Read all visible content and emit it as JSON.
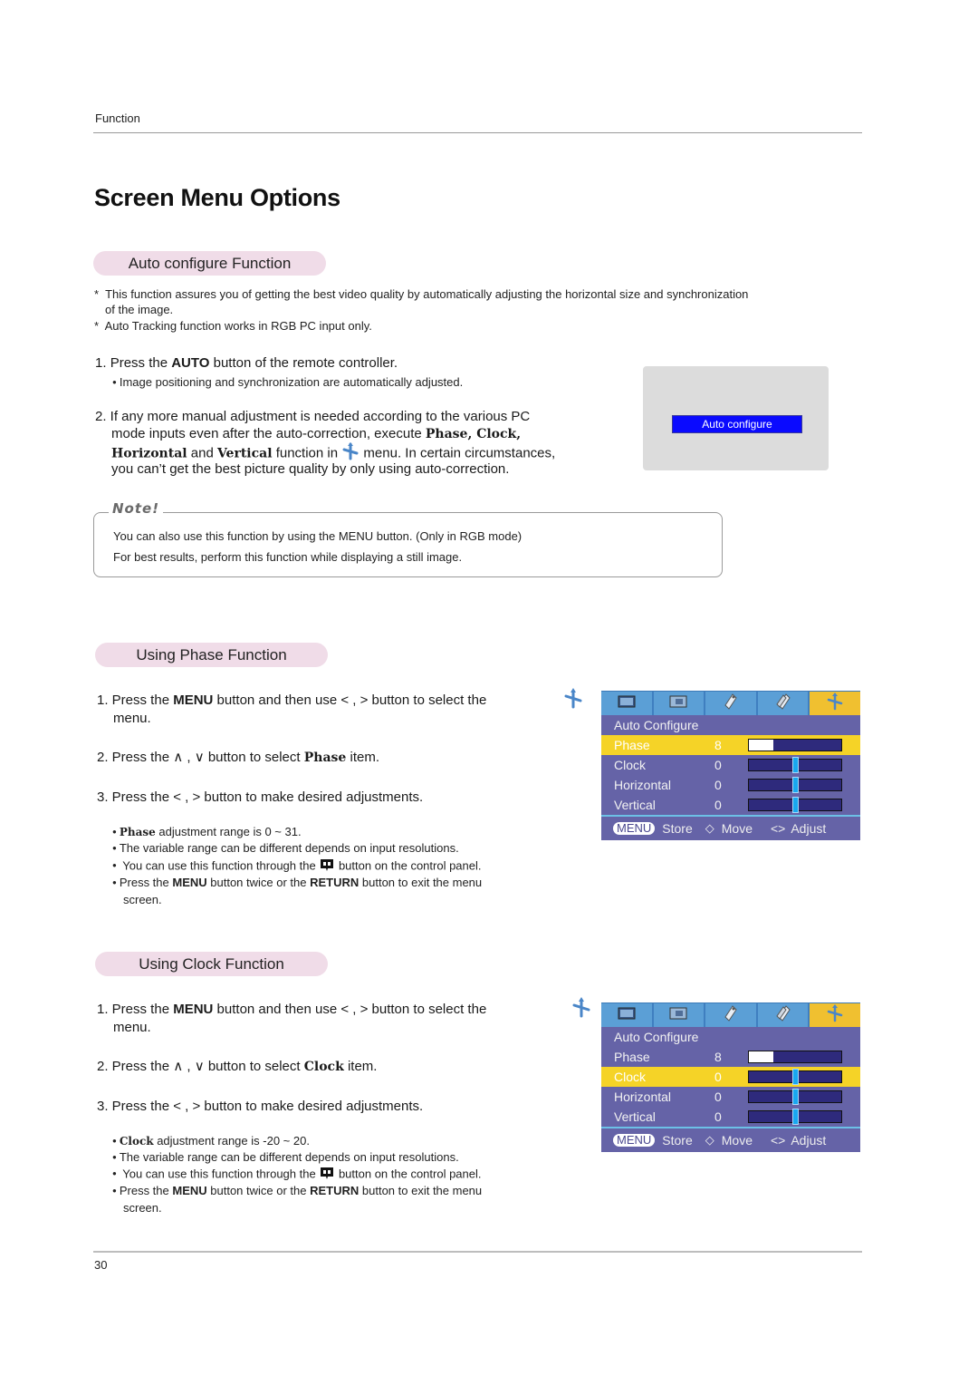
{
  "header": {
    "section_label": "Function"
  },
  "page_title": "Screen Menu Options",
  "auto_configure": {
    "heading": "Auto configure Function",
    "notes": [
      "This function assures you of getting the best video quality by automatically adjusting the horizontal size and synchronization",
      "of the image.",
      "Auto Tracking function works in RGB PC input only."
    ],
    "step1": {
      "num": "1.",
      "pre": "Press the ",
      "bold": "AUTO",
      "post": " button of the remote controller."
    },
    "step1_bullet": "Image positioning and synchronization are automatically adjusted.",
    "step2": {
      "line1": "2. If any more manual adjustment is needed according to the various PC",
      "line2_pre": "mode inputs even after the auto-correction, execute ",
      "line2_bold": "Phase, Clock,",
      "line3_bold1": "Horizontal",
      "line3_mid": " and ",
      "line3_bold2": "Vertical",
      "line3_post": " function in ",
      "line3_end": " menu. In certain circumstances,",
      "line4": "you can’t get the best picture quality by only using auto-correction."
    },
    "screen_button": "Auto configure",
    "note_title": "Note!",
    "note_lines": [
      "You can also use this function by using the MENU button. (Only in RGB mode)",
      "For best results, perform this function while displaying a still image."
    ]
  },
  "phase": {
    "heading": "Using Phase Function",
    "step1_a": "1. Press the ",
    "step1_bold": "MENU",
    "step1_b": " button and then use < , > button to select the",
    "step1_c": "menu.",
    "step2_a": "2. Press the ∧ , ∨ button to select ",
    "step2_bold": "Phase",
    "step2_b": " item.",
    "step3": "3. Press the < , > button to make desired adjustments.",
    "bullet1_bold": "Phase",
    "bullet1": " adjustment range is 0 ~ 31.",
    "bullet2": "The variable range can be different depends on input resolutions.",
    "bullet3_a": "You can use this function through the",
    "bullet3_b": "button on the control panel.",
    "bullet4_a": "Press the ",
    "bullet4_bold1": "MENU",
    "bullet4_b": " button twice or the ",
    "bullet4_bold2": "RETURN",
    "bullet4_c": " button to exit the menu",
    "bullet4_d": "screen."
  },
  "clock": {
    "heading": "Using Clock Function",
    "step1_a": "1. Press the ",
    "step1_bold": "MENU",
    "step1_b": " button and then use < , > button to select the",
    "step1_c": "menu.",
    "step2_a": "2. Press the ∧ , ∨ button to select ",
    "step2_bold": "Clock",
    "step2_b": " item.",
    "step3": "3. Press the < , > button to make desired adjustments.",
    "bullet1_bold": "Clock",
    "bullet1": " adjustment range is -20 ~ 20.",
    "bullet2": "The variable range can be different depends on input resolutions.",
    "bullet3_a": "You can use this function through the",
    "bullet3_b": "button on the control panel.",
    "bullet4_a": "Press the ",
    "bullet4_bold1": "MENU",
    "bullet4_b": " button twice or the ",
    "bullet4_bold2": "RETURN",
    "bullet4_c": " button to exit the menu",
    "bullet4_d": "screen."
  },
  "osd_phase": {
    "tabs": [
      "picture-icon",
      "screen-icon",
      "tag-icon",
      "tags-icon",
      "move-cross-icon"
    ],
    "title_row": "Auto Configure",
    "rows": [
      {
        "label": "Phase",
        "value": "8",
        "kind": "fill",
        "fraction": 0.26,
        "selected": true
      },
      {
        "label": "Clock",
        "value": "0",
        "kind": "knob",
        "fraction": 0.5,
        "selected": false
      },
      {
        "label": "Horizontal",
        "value": "0",
        "kind": "knob",
        "fraction": 0.5,
        "selected": false
      },
      {
        "label": "Vertical",
        "value": "0",
        "kind": "knob",
        "fraction": 0.5,
        "selected": false
      }
    ],
    "footer": {
      "menu": "MENU",
      "store": "Store",
      "move_icon": "◇",
      "move": "Move",
      "adjust_icon": "<>",
      "adjust": "Adjust"
    }
  },
  "osd_clock": {
    "tabs": [
      "picture-icon",
      "screen-icon",
      "tag-icon",
      "tags-icon",
      "move-cross-icon"
    ],
    "title_row": "Auto Configure",
    "rows": [
      {
        "label": "Phase",
        "value": "8",
        "kind": "fill",
        "fraction": 0.26,
        "selected": false
      },
      {
        "label": "Clock",
        "value": "0",
        "kind": "knob",
        "fraction": 0.5,
        "selected": true
      },
      {
        "label": "Horizontal",
        "value": "0",
        "kind": "knob",
        "fraction": 0.5,
        "selected": false
      },
      {
        "label": "Vertical",
        "value": "0",
        "kind": "knob",
        "fraction": 0.5,
        "selected": false
      }
    ],
    "footer": {
      "menu": "MENU",
      "store": "Store",
      "move_icon": "◇",
      "move": "Move",
      "adjust_icon": "<>",
      "adjust": "Adjust"
    }
  },
  "footer": {
    "page_number": "30"
  }
}
